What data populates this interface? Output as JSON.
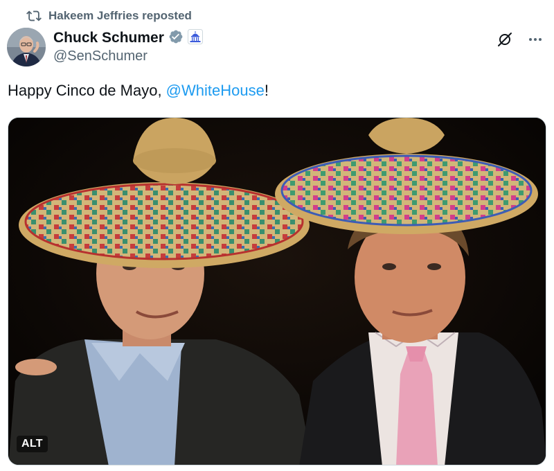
{
  "repost": {
    "icon": "repost-icon",
    "label": "Hakeem Jeffries reposted"
  },
  "author": {
    "display_name": "Chuck Schumer",
    "handle": "@SenSchumer",
    "verified_icon": "verified-badge-icon",
    "affiliation_icon": "capitol-building-icon"
  },
  "actions": {
    "grok_icon": "grok-icon",
    "more_icon": "more-options-icon"
  },
  "post": {
    "text_before": "Happy Cinco de Mayo, ",
    "mention": "@WhiteHouse",
    "text_after": "!"
  },
  "media": {
    "alt_label": "ALT"
  },
  "colors": {
    "text": "#0f1419",
    "secondary": "#536471",
    "link": "#1d9bf0",
    "verified": "#829aab",
    "affiliation": "#3b5bdb"
  }
}
